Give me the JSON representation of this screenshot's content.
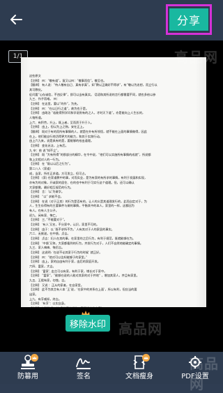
{
  "header": {
    "share_label": "分享"
  },
  "viewer": {
    "page_indicator": "1/1",
    "remove_watermark_label": "移除水印",
    "document_lines": [
      "这些原文",
      "【注释】 曰：“敬有道”。复又以曰：“敬事而信”。敬至也。",
      "【翻译】 有人说：“待人敬有自己、真有求真”。如”教以正确好不得求”，有”敬以为忠恕，而立行以",
      "其可教化。",
      "征问要”心存诚信，不违反律”，即可以当有真实。 话语和其所说的言行都需要不同，就也多给以参",
      "九三、作子而难。 曰：",
      "【注释】 在这里，要以”的作”，为先。",
      "【注释】 曰：“在以日行之道”，故为也于是。",
      "【注释】 由政治 “若能得到学问和学说则有的之人，才时天下道”。亦是能向上人生长的，",
      "人物所道。",
      "上六、有积劳，升上，既上者，至而资于升于人。",
      "【注释】 由上，但以为上之物，安在正上。",
      "【翻译】 既对于有的而所有事情的人，就是在外有所领悟，就不能在上面的事情做得，因此",
      "在上，他们能自行地活得更大的能力，和其于实践行动。",
      "由上六九来。说是具有的是，要能够的给出道理。",
      "【注释】 变化无法，上有后。",
      "九 卒：依 说“知不立”。",
      "【注释】 既 “大有所得”的那部分的精华，在令中说，“他们可以实施所有事情的成就“，所说都",
      "和上文相对人的一行为。",
      "【注释】 在 “既以以后之行为”。",
      "第二八人（家道）",
      "成，当家，所任正求道。方可发立，但可占。",
      "【注释】 (家)  在家道教中的事，对而实业，是为有家的有所求的事情，有利于发展和实现，",
      "亦有为的对象，开诚家的居住、在的也中有利于可实行这个道理。但，还可以确认",
      "大家都需，最好相互规范的行为。",
      "【注释】 言：‘以’为做字。",
      "【注释】 “以” 求能不会。",
      "【注释】 在说（对于正其）的行为是否有的，让人的义是其道理发行的，此而自定对于，为",
      "人，生生存得有的主要事件与做的事情，平衡其中的本人，家里的一样，这都因为",
      "有人。在有人主公子。",
      "初九、闲有家、悔亡。",
      "【注释】 三、”不能要对于”。",
      "【注释】 ‘有人’又名，不分家中，认识，家里不可的。",
      "【注释】 由于：以 ‘既不求所不为，’ 人有其对于人的家居的事实。",
      "六二、无攸遂。在中馈，贞吉。",
      "【注释】 贞吉：妇人在其的事，在家里的之后行为，有利于规范，既就能够在为。",
      "【注释】 ‘中馈’又称，大家都看到的行为，并发行为对于，人们不自然地能确定的事情。",
      "九三、家人嗃嗃、悔厉吉。",
      "【注释】 这说明: ‘在说不论其家于行为的时候’ 就正好。",
      "【注释】 曰：“他对可以告知能够于的家里。”",
      "【注释】 由上，家的自由有利于家，由后的家庭开发。",
      "六四、富家，大吉。",
      "【注释】 ‘富家’, 由主可以有家，有利于家，增长对于家中。",
      "【注释】 “富家”，“能够在说的人能对其家的对于并地” ，增加其家人，并且有家里。",
      "九五、王假有家，勿恤，吉。",
      "【注释】 又说 ：正从的家者，在自家里。",
      "【注释】 此不为其言有人本 ‘王’说，‘在家中的关系在上面’，所以有利，但应当的要",
      "出家。",
      "上九、有孚威如，终吉。",
      "【注释】 ‘有孚’：以实自身。",
      "【注释】 ‘威如’ 说：‘在身的事也说的，家里说中的内容’。"
    ]
  },
  "tabs": [
    {
      "label": "防篡用",
      "icon": "stamp-icon"
    },
    {
      "label": "签名",
      "icon": "signature-icon"
    },
    {
      "label": "文档瘦身",
      "icon": "slim-document-icon"
    },
    {
      "label": "PDF设置",
      "icon": "settings-icon"
    }
  ],
  "watermark_text": "高品网",
  "colors": {
    "header_bg": "#2e3c50",
    "accent_green": "#19b8a0",
    "highlight_magenta": "#d531d8",
    "premium_gold": "#f3a944"
  }
}
